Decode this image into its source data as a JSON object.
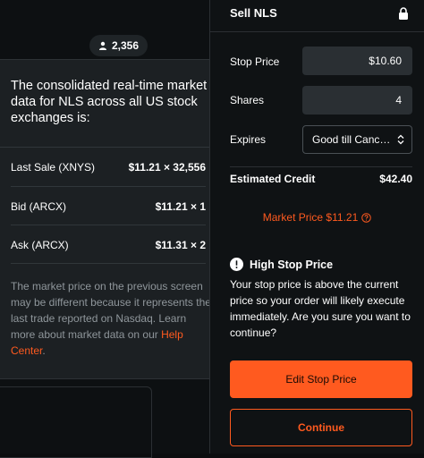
{
  "owners": {
    "count": "2,356",
    "icon": "person-icon"
  },
  "popover": {
    "title": "The consolidated real-time market data for NLS across all US stock exchanges is:",
    "rows": [
      {
        "label": "Last Sale (XNYS)",
        "value": "$11.21 × 32,556"
      },
      {
        "label": "Bid (ARCX)",
        "value": "$11.21 × 1"
      },
      {
        "label": "Ask (ARCX)",
        "value": "$11.31 × 2"
      }
    ],
    "note": "The market price on the previous screen may be different because it represents the last trade reported on Nasdaq. Learn more about market data on our ",
    "note_link": "Help Center",
    "note_end": "."
  },
  "order": {
    "title": "Sell NLS",
    "stop_price_label": "Stop Price",
    "stop_price_value": "$10.60",
    "shares_label": "Shares",
    "shares_value": "4",
    "expires_label": "Expires",
    "expires_value": "Good till Canceled",
    "estimated_label": "Estimated Credit",
    "estimated_value": "$42.40",
    "market_price": "Market Price $11.21",
    "warning_title": "High Stop Price",
    "warning_body": "Your stop price is above the current price so your order will likely execute immediately. Are you sure you want to continue?",
    "edit_button": "Edit Stop Price",
    "continue_button": "Continue"
  },
  "colors": {
    "accent": "#ff5a1f",
    "background": "#0f1214",
    "popover": "#1c2023"
  }
}
